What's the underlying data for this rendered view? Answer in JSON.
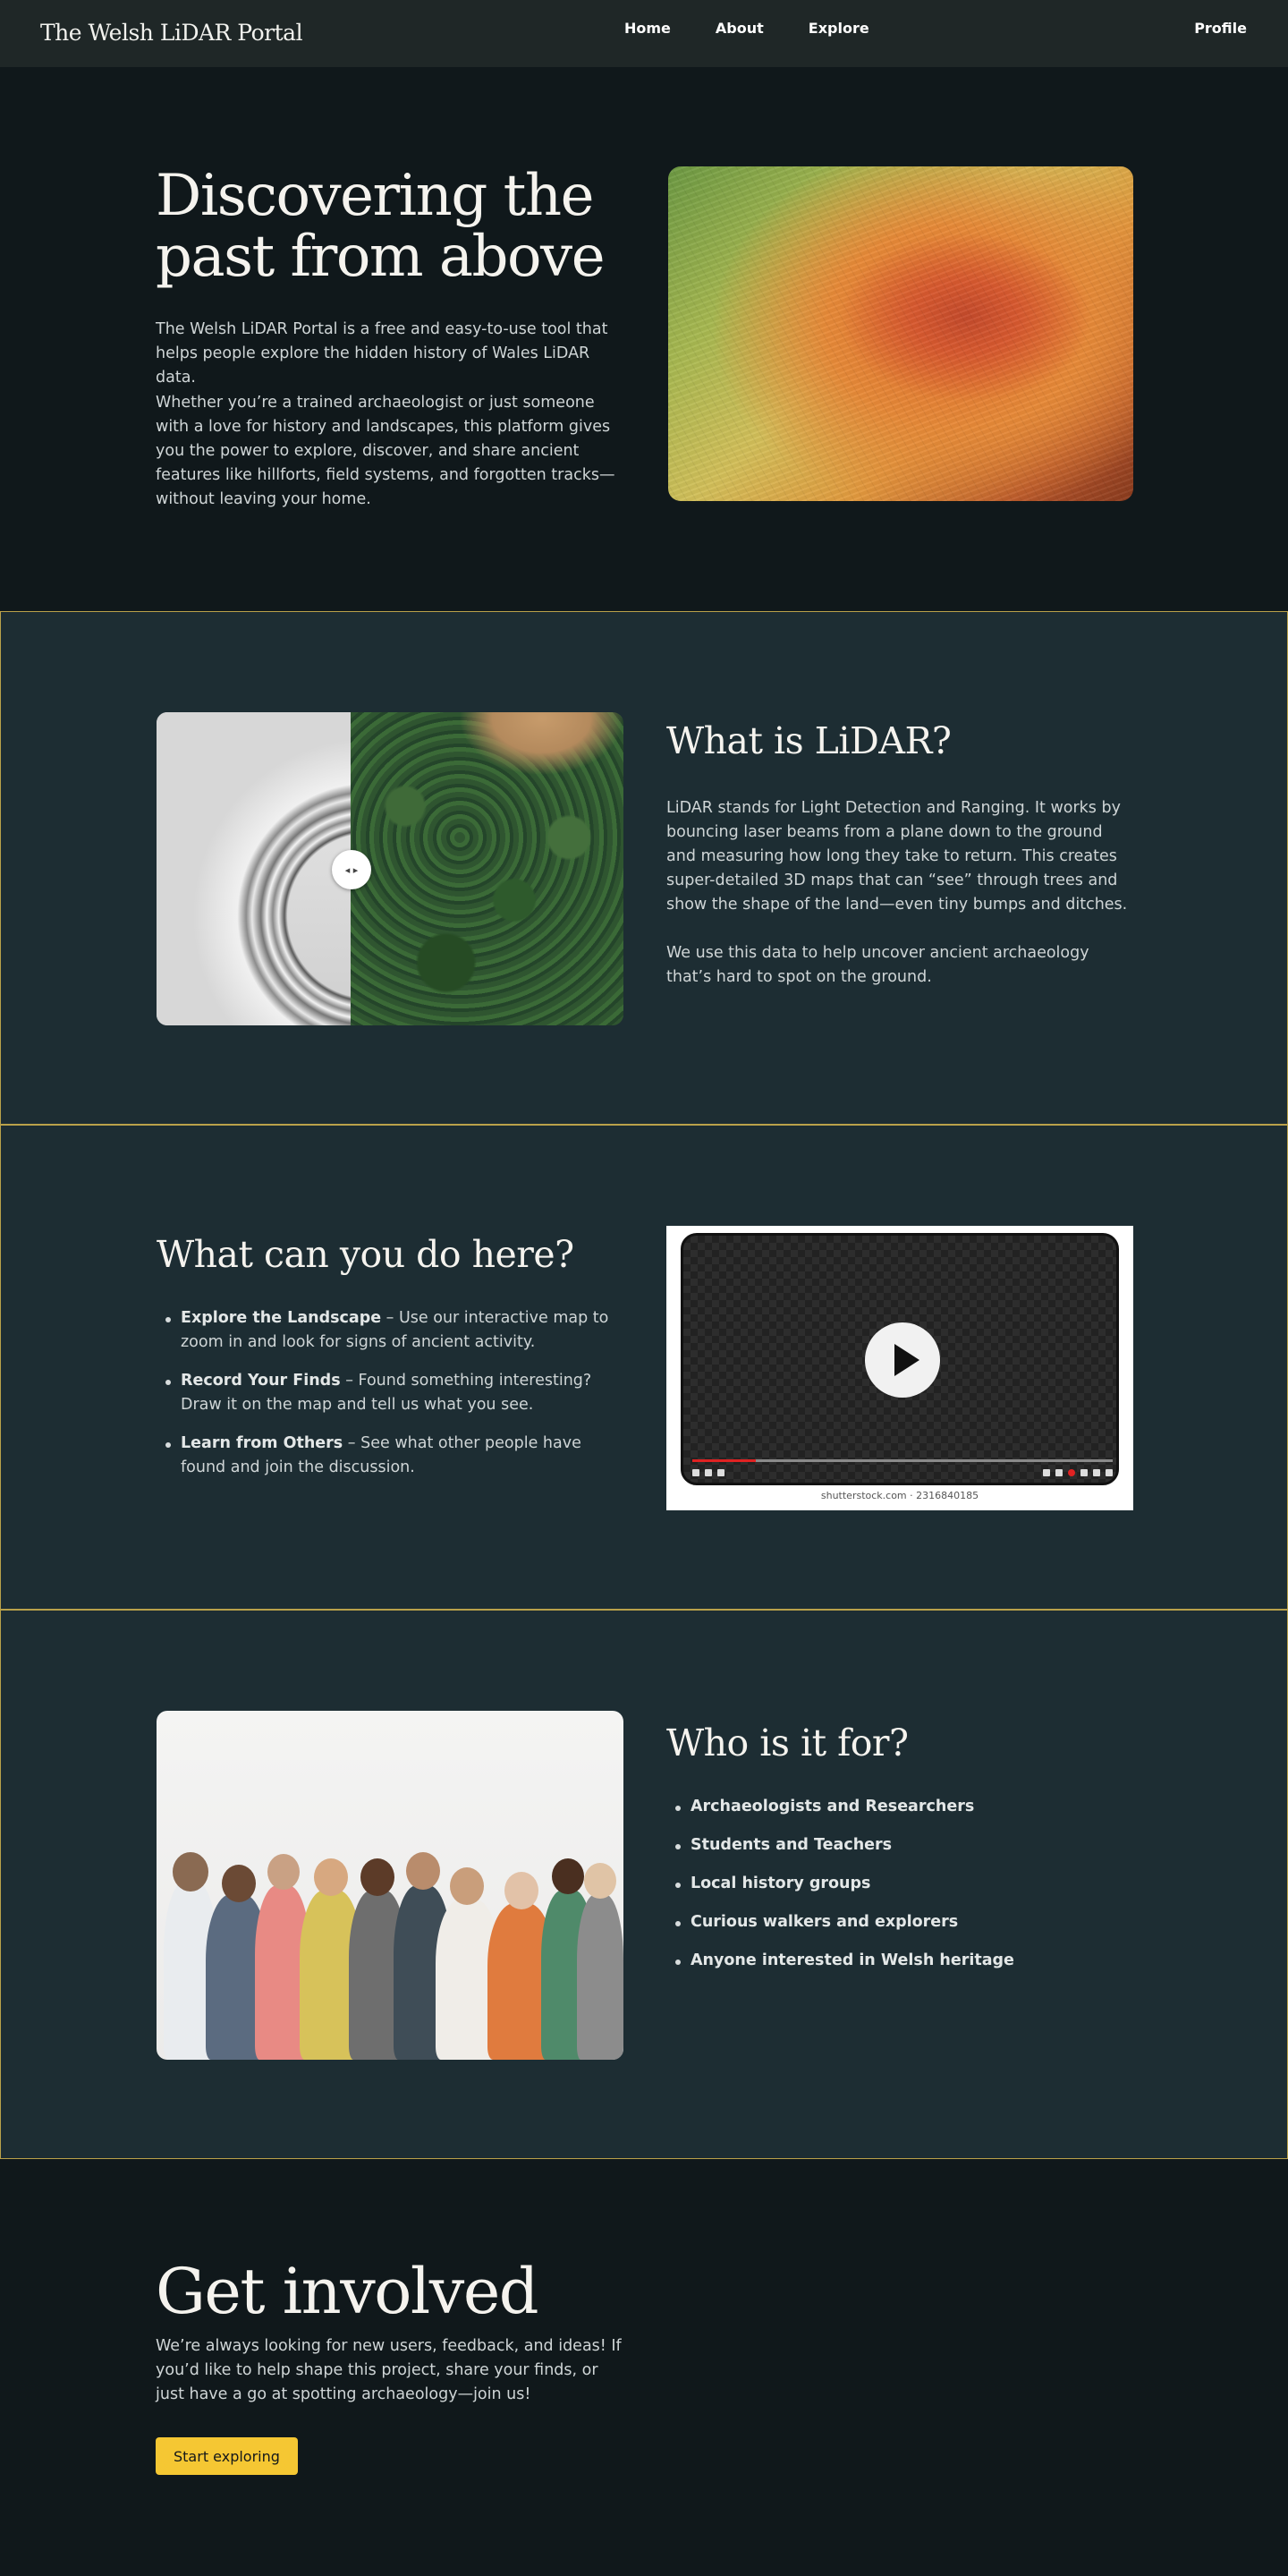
{
  "nav": {
    "brand": "The Welsh LiDAR Portal",
    "links": [
      "Home",
      "About",
      "Explore"
    ],
    "profile": "Profile"
  },
  "hero": {
    "title": "Discovering the past from above",
    "p1": "The Welsh LiDAR Portal is a free and easy-to-use tool that helps people explore the hidden history of Wales LiDAR data.",
    "p2": "Whether you’re a trained archaeologist or just someone with a love for history and landscapes, this platform gives you the power to explore, discover, and share ancient features like hillforts, field systems, and forgotten tracks—without leaving your home."
  },
  "lidar": {
    "title": "What is LiDAR?",
    "p1": "LiDAR stands for Light Detection and Ranging. It works by bouncing laser beams from a plane down to the ground and measuring how long they take to return. This creates super-detailed 3D maps that can “see” through trees and show the shape of the land—even tiny bumps and ditches.",
    "p2": "We use this data to help uncover ancient archaeology that’s hard to spot on the ground.",
    "handle_icon": "compare-arrows-icon"
  },
  "do": {
    "title": "What can you do here?",
    "items": [
      {
        "strong": "Explore the Landscape",
        "text": " – Use our interactive map to zoom in and look for signs of ancient activity."
      },
      {
        "strong": "Record Your Finds",
        "text": " – Found something interesting? Draw it on the map and tell us what you see."
      },
      {
        "strong": "Learn from Others",
        "text": " – See what other people have found and join the discussion."
      }
    ],
    "video": {
      "watermark": "shutterstock.com · 2316840185",
      "progress": 0.15
    }
  },
  "who": {
    "title": "Who is it for?",
    "items": [
      "Archaeologists and Researchers",
      "Students and Teachers",
      "Local history groups",
      "Curious walkers and explorers",
      "Anyone interested in Welsh heritage"
    ]
  },
  "involved": {
    "title": "Get involved",
    "p": "We’re always looking for new users, feedback, and ideas! If you’d like to help shape this project, share your finds, or just have a go at spotting archaeology—join us!",
    "button": "Start exploring",
    "accent": "#f5c733"
  }
}
